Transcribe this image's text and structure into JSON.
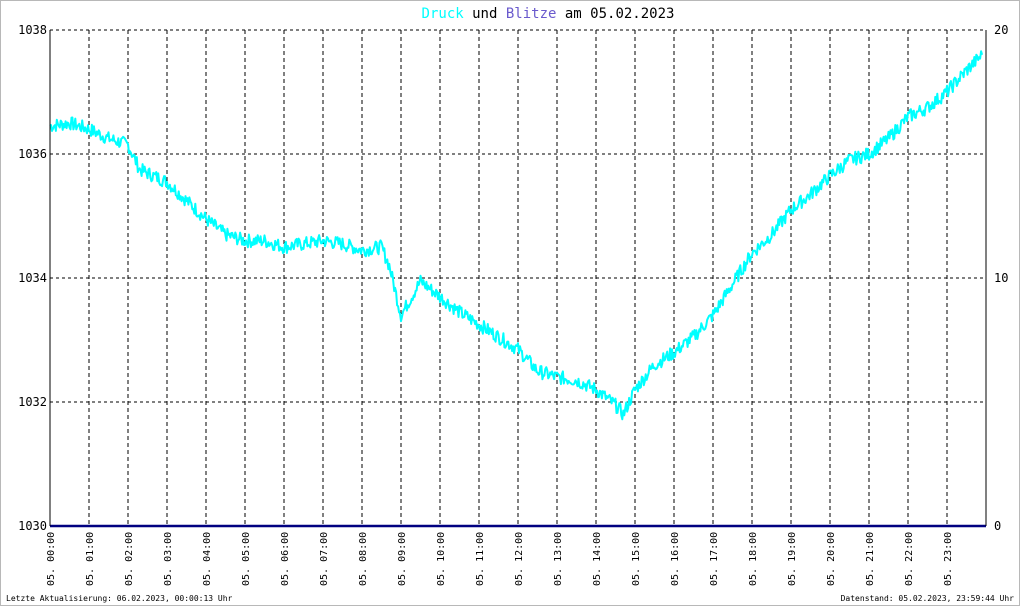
{
  "footer": {
    "last_update": "Letzte Aktualisierung: 06.02.2023, 00:00:13 Uhr",
    "data_status": "Datenstand: 05.02.2023, 23:59:44 Uhr"
  },
  "colors": {
    "pressure": "#00ffff",
    "lightning": "#000080",
    "title_blitze": "#6a5acd",
    "grid": "#000000"
  },
  "chart_data": {
    "type": "line",
    "title_parts": [
      {
        "text": "Druck",
        "color": "#00ffff"
      },
      {
        "text": " und ",
        "color": "#000000"
      },
      {
        "text": "Blitze",
        "color": "#6a5acd"
      },
      {
        "text": " am 05.02.2023",
        "color": "#000000"
      }
    ],
    "x_range": [
      0,
      24
    ],
    "x_ticks": [
      {
        "x": 0,
        "label": "05. 00:00"
      },
      {
        "x": 1,
        "label": "05. 01:00"
      },
      {
        "x": 2,
        "label": "05. 02:00"
      },
      {
        "x": 3,
        "label": "05. 03:00"
      },
      {
        "x": 4,
        "label": "05. 04:00"
      },
      {
        "x": 5,
        "label": "05. 05:00"
      },
      {
        "x": 6,
        "label": "05. 06:00"
      },
      {
        "x": 7,
        "label": "05. 07:00"
      },
      {
        "x": 8,
        "label": "05. 08:00"
      },
      {
        "x": 9,
        "label": "05. 09:00"
      },
      {
        "x": 10,
        "label": "05. 10:00"
      },
      {
        "x": 11,
        "label": "05. 11:00"
      },
      {
        "x": 12,
        "label": "05. 12:00"
      },
      {
        "x": 13,
        "label": "05. 13:00"
      },
      {
        "x": 14,
        "label": "05. 14:00"
      },
      {
        "x": 15,
        "label": "05. 15:00"
      },
      {
        "x": 16,
        "label": "05. 16:00"
      },
      {
        "x": 17,
        "label": "05. 17:00"
      },
      {
        "x": 18,
        "label": "05. 18:00"
      },
      {
        "x": 19,
        "label": "05. 19:00"
      },
      {
        "x": 20,
        "label": "05. 20:00"
      },
      {
        "x": 21,
        "label": "05. 21:00"
      },
      {
        "x": 22,
        "label": "05. 22:00"
      },
      {
        "x": 23,
        "label": "05. 23:00"
      }
    ],
    "y_left": {
      "range": [
        1030,
        1038
      ],
      "ticks": [
        "1030",
        "1032",
        "1034",
        "1036",
        "1038"
      ]
    },
    "y_right": {
      "range": [
        0,
        20
      ],
      "ticks": [
        "0",
        "10",
        "20"
      ]
    },
    "grid": true,
    "series": [
      {
        "axis": "left",
        "color": "#00ffff",
        "x": [
          0,
          0.5,
          1,
          1.5,
          2,
          2.3,
          3,
          3.5,
          4,
          4.5,
          5,
          5.5,
          6,
          6.5,
          7,
          7.5,
          8,
          8.5,
          8.7,
          9.0,
          9.5,
          10,
          10.5,
          11,
          11.5,
          12,
          12.5,
          13,
          13.5,
          14,
          14.5,
          14.7,
          15,
          15.5,
          16,
          16.5,
          17,
          17.5,
          18,
          18.5,
          19,
          19.5,
          20,
          20.5,
          21,
          21.5,
          22,
          22.5,
          23,
          23.5,
          23.9
        ],
        "y": [
          1036.45,
          1036.5,
          1036.4,
          1036.25,
          1036.15,
          1035.75,
          1035.55,
          1035.25,
          1034.95,
          1034.7,
          1034.6,
          1034.6,
          1034.5,
          1034.55,
          1034.6,
          1034.55,
          1034.45,
          1034.5,
          1034.2,
          1033.4,
          1033.95,
          1033.7,
          1033.45,
          1033.25,
          1033.05,
          1032.85,
          1032.5,
          1032.4,
          1032.35,
          1032.2,
          1031.95,
          1031.8,
          1032.2,
          1032.6,
          1032.8,
          1033.05,
          1033.4,
          1033.9,
          1034.4,
          1034.7,
          1035.1,
          1035.35,
          1035.65,
          1035.9,
          1036.0,
          1036.25,
          1036.6,
          1036.75,
          1037.0,
          1037.35,
          1037.6
        ]
      },
      {
        "axis": "right",
        "color": "#000080",
        "x": [
          0,
          24
        ],
        "y": [
          0,
          0
        ]
      }
    ]
  }
}
